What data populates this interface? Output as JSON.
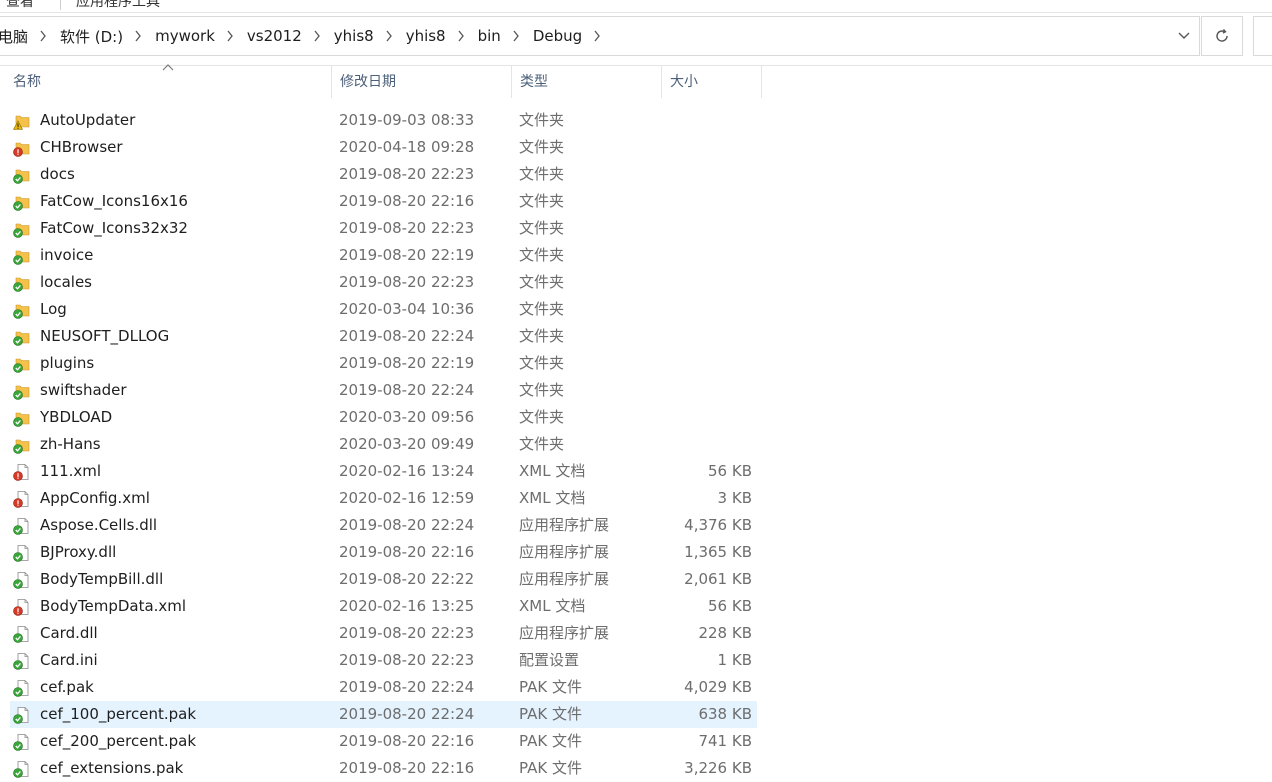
{
  "ribbon": {
    "tab_left": "查看",
    "tab_right": "应用程序工具"
  },
  "breadcrumb": [
    "电脑",
    "软件 (D:)",
    "mywork",
    "vs2012",
    "yhis8",
    "yhis8",
    "bin",
    "Debug"
  ],
  "columns": {
    "name": "名称",
    "date": "修改日期",
    "type": "类型",
    "size": "大小"
  },
  "colors": {
    "status_ok": "#3aa53a",
    "status_error": "#d63a26",
    "status_warn": "#e8b500",
    "folder": "#f4c24a",
    "selection": "#e5f3ff"
  },
  "files": [
    {
      "name": "AutoUpdater",
      "date": "2019-09-03 08:33",
      "type": "文件夹",
      "size": "",
      "kind": "folder",
      "status": "warn"
    },
    {
      "name": "CHBrowser",
      "date": "2020-04-18 09:28",
      "type": "文件夹",
      "size": "",
      "kind": "folder",
      "status": "error"
    },
    {
      "name": "docs",
      "date": "2019-08-20 22:23",
      "type": "文件夹",
      "size": "",
      "kind": "folder",
      "status": "ok"
    },
    {
      "name": "FatCow_Icons16x16",
      "date": "2019-08-20 22:16",
      "type": "文件夹",
      "size": "",
      "kind": "folder",
      "status": "ok"
    },
    {
      "name": "FatCow_Icons32x32",
      "date": "2019-08-20 22:23",
      "type": "文件夹",
      "size": "",
      "kind": "folder",
      "status": "ok"
    },
    {
      "name": "invoice",
      "date": "2019-08-20 22:19",
      "type": "文件夹",
      "size": "",
      "kind": "folder",
      "status": "ok"
    },
    {
      "name": "locales",
      "date": "2019-08-20 22:23",
      "type": "文件夹",
      "size": "",
      "kind": "folder",
      "status": "ok"
    },
    {
      "name": "Log",
      "date": "2020-03-04 10:36",
      "type": "文件夹",
      "size": "",
      "kind": "folder",
      "status": "ok"
    },
    {
      "name": "NEUSOFT_DLLOG",
      "date": "2019-08-20 22:24",
      "type": "文件夹",
      "size": "",
      "kind": "folder",
      "status": "ok"
    },
    {
      "name": "plugins",
      "date": "2019-08-20 22:19",
      "type": "文件夹",
      "size": "",
      "kind": "folder",
      "status": "ok"
    },
    {
      "name": "swiftshader",
      "date": "2019-08-20 22:24",
      "type": "文件夹",
      "size": "",
      "kind": "folder",
      "status": "ok"
    },
    {
      "name": "YBDLOAD",
      "date": "2020-03-20 09:56",
      "type": "文件夹",
      "size": "",
      "kind": "folder",
      "status": "ok"
    },
    {
      "name": "zh-Hans",
      "date": "2020-03-20 09:49",
      "type": "文件夹",
      "size": "",
      "kind": "folder",
      "status": "ok"
    },
    {
      "name": "111.xml",
      "date": "2020-02-16 13:24",
      "type": "XML 文档",
      "size": "56 KB",
      "kind": "file",
      "status": "error"
    },
    {
      "name": "AppConfig.xml",
      "date": "2020-02-16 12:59",
      "type": "XML 文档",
      "size": "3 KB",
      "kind": "file",
      "status": "error"
    },
    {
      "name": "Aspose.Cells.dll",
      "date": "2019-08-20 22:24",
      "type": "应用程序扩展",
      "size": "4,376 KB",
      "kind": "file",
      "status": "ok"
    },
    {
      "name": "BJProxy.dll",
      "date": "2019-08-20 22:16",
      "type": "应用程序扩展",
      "size": "1,365 KB",
      "kind": "file",
      "status": "ok"
    },
    {
      "name": "BodyTempBill.dll",
      "date": "2019-08-20 22:22",
      "type": "应用程序扩展",
      "size": "2,061 KB",
      "kind": "file",
      "status": "ok"
    },
    {
      "name": "BodyTempData.xml",
      "date": "2020-02-16 13:25",
      "type": "XML 文档",
      "size": "56 KB",
      "kind": "file",
      "status": "error"
    },
    {
      "name": "Card.dll",
      "date": "2019-08-20 22:23",
      "type": "应用程序扩展",
      "size": "228 KB",
      "kind": "file",
      "status": "ok"
    },
    {
      "name": "Card.ini",
      "date": "2019-08-20 22:23",
      "type": "配置设置",
      "size": "1 KB",
      "kind": "file",
      "status": "ok"
    },
    {
      "name": "cef.pak",
      "date": "2019-08-20 22:24",
      "type": "PAK 文件",
      "size": "4,029 KB",
      "kind": "file",
      "status": "ok"
    },
    {
      "name": "cef_100_percent.pak",
      "date": "2019-08-20 22:24",
      "type": "PAK 文件",
      "size": "638 KB",
      "kind": "file",
      "status": "ok",
      "selected": true
    },
    {
      "name": "cef_200_percent.pak",
      "date": "2019-08-20 22:16",
      "type": "PAK 文件",
      "size": "741 KB",
      "kind": "file",
      "status": "ok"
    },
    {
      "name": "cef_extensions.pak",
      "date": "2019-08-20 22:16",
      "type": "PAK 文件",
      "size": "3,226 KB",
      "kind": "file",
      "status": "ok"
    }
  ]
}
